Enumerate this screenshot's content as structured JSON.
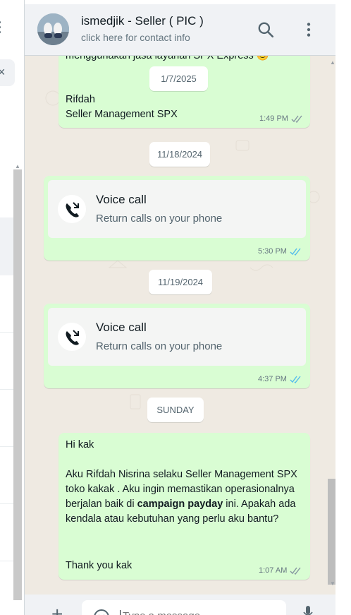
{
  "header": {
    "contact_name": "ismedjik - Seller ( PIC )",
    "contact_sub": "click here for contact info",
    "icons": [
      "search-icon",
      "menu-icon"
    ]
  },
  "messages": {
    "top_cut_text": "menggunakan jasa layanan SPX Express 😊",
    "date_1": "1/7/2025",
    "msg1_line1": "Rifdah",
    "msg1_line2": "Seller Management SPX",
    "msg1_time": "1:49 PM",
    "date_2": "11/18/2024",
    "call1_title": "Voice call",
    "call1_sub": "Return calls on your phone",
    "call1_time": "5:30 PM",
    "date_3": "11/19/2024",
    "call2_title": "Voice call",
    "call2_sub": "Return calls on your phone",
    "call2_time": "4:37 PM",
    "date_4": "SUNDAY",
    "msg3_greet": "Hi kak",
    "msg3_p1": "Aku Rifdah Nisrina selaku Seller Management SPX toko kakak . Aku ingin memastikan operasionalnya berjalan baik di ",
    "msg3_bold": "campaign payday",
    "msg3_p2": " ini. Apakah ada kendala atau kebutuhan yang perlu aku bantu?",
    "msg3_thanks": "Thank you kak",
    "msg3_time": "1:07 AM"
  },
  "composer": {
    "placeholder": "Type a message",
    "plus_label": "+"
  },
  "colors": {
    "outgoing_bubble": "#d9fdd3",
    "chat_background": "#efeae2",
    "header_background": "#f0f2f5",
    "read_tick": "#53bdeb",
    "delivered_tick": "#8696a0"
  }
}
